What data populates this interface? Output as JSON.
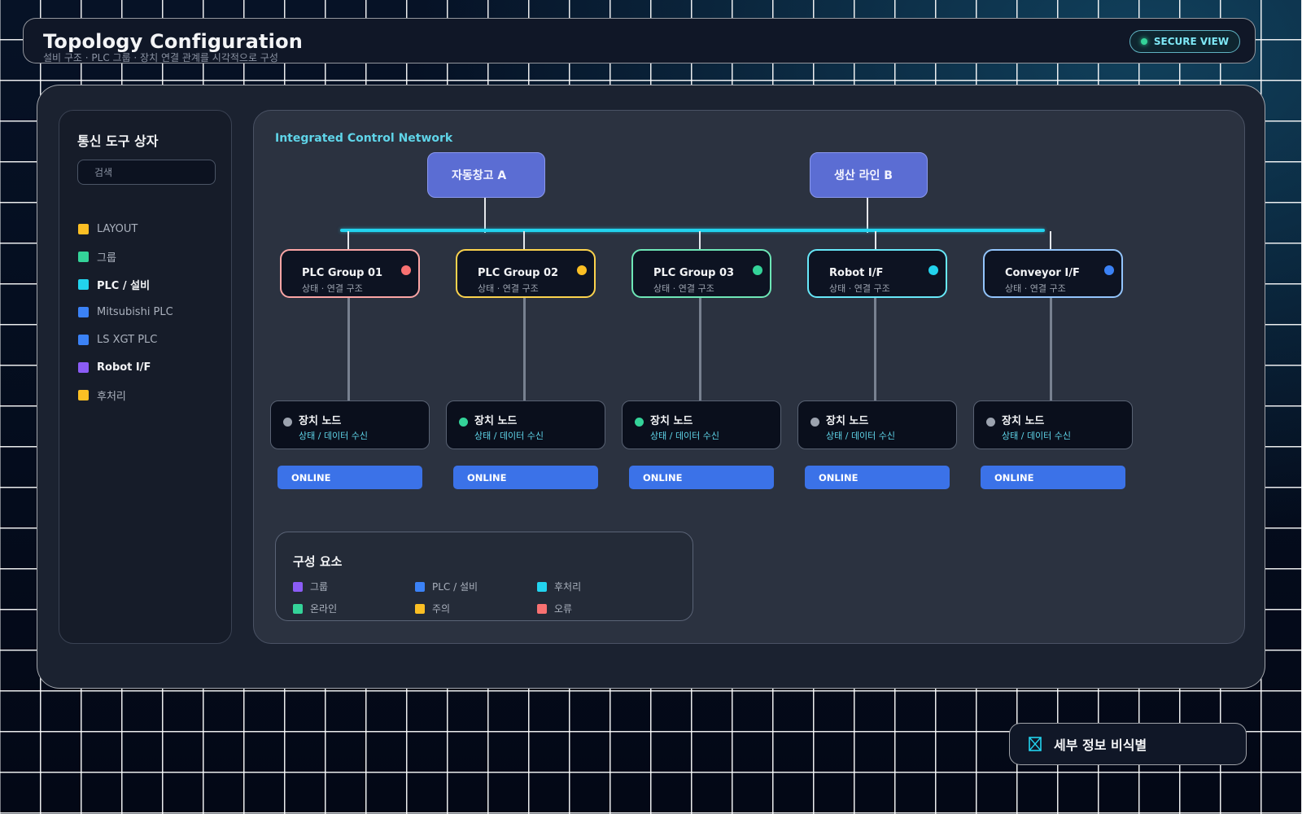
{
  "header": {
    "title": "Topology Configuration",
    "subtitle": "설비 구조 · PLC 그룹 · 장치 연결 관계를 시각적으로 구성",
    "secure_label": "SECURE VIEW"
  },
  "sidebar": {
    "title": "통신 도구 상자",
    "search_placeholder": "검색",
    "items": [
      {
        "label": "LAYOUT",
        "color": "#fbbf24",
        "bold": false
      },
      {
        "label": "그룹",
        "color": "#34d399",
        "bold": false
      },
      {
        "label": "PLC / 설비",
        "color": "#22d3ee",
        "bold": true
      },
      {
        "label": "Mitsubishi PLC",
        "color": "#3b82f6",
        "bold": false
      },
      {
        "label": "LS XGT PLC",
        "color": "#3b82f6",
        "bold": false
      },
      {
        "label": "Robot I/F",
        "color": "#8b5cf6",
        "bold": true
      },
      {
        "label": "후처리",
        "color": "#fbbf24",
        "bold": false
      }
    ]
  },
  "canvas": {
    "title": "Integrated Control Network",
    "sites": [
      {
        "label": "자동창고 A"
      },
      {
        "label": "생산 라인 B"
      }
    ],
    "groups": [
      {
        "name": "PLC Group 01",
        "sub": "상태 · 연결 구조",
        "border_color": "#fca5a5",
        "dot_color": "#f87171"
      },
      {
        "name": "PLC Group 02",
        "sub": "상태 · 연결 구조",
        "border_color": "#fcd34d",
        "dot_color": "#fbbf24"
      },
      {
        "name": "PLC Group 03",
        "sub": "상태 · 연결 구조",
        "border_color": "#6ee7b7",
        "dot_color": "#34d399"
      },
      {
        "name": "Robot I/F",
        "sub": "상태 · 연결 구조",
        "border_color": "#67e8f9",
        "dot_color": "#22d3ee"
      },
      {
        "name": "Conveyor I/F",
        "sub": "상태 · 연결 구조",
        "border_color": "#93c5fd",
        "dot_color": "#3b82f6"
      }
    ],
    "devices": [
      {
        "name": "장치 노드",
        "sub": "상태 / 데이터 수신",
        "dot_color": "#9ca3af",
        "status": "ONLINE"
      },
      {
        "name": "장치 노드",
        "sub": "상태 / 데이터 수신",
        "dot_color": "#34d399",
        "status": "ONLINE"
      },
      {
        "name": "장치 노드",
        "sub": "상태 / 데이터 수신",
        "dot_color": "#34d399",
        "status": "ONLINE"
      },
      {
        "name": "장치 노드",
        "sub": "상태 / 데이터 수신",
        "dot_color": "#9ca3af",
        "status": "ONLINE"
      },
      {
        "name": "장치 노드",
        "sub": "상태 / 데이터 수신",
        "dot_color": "#9ca3af",
        "status": "ONLINE"
      }
    ]
  },
  "legend": {
    "title": "구성 요소",
    "items": [
      {
        "label": "그룹",
        "color": "#8b5cf6"
      },
      {
        "label": "PLC / 설비",
        "color": "#3b82f6"
      },
      {
        "label": "후처리",
        "color": "#22d3ee"
      },
      {
        "label": "온라인",
        "color": "#34d399"
      },
      {
        "label": "주의",
        "color": "#fbbf24"
      },
      {
        "label": "오류",
        "color": "#f87171"
      }
    ]
  },
  "privacy_toggle": {
    "label": "세부 정보 비식별",
    "icon": "masked-id-icon"
  }
}
